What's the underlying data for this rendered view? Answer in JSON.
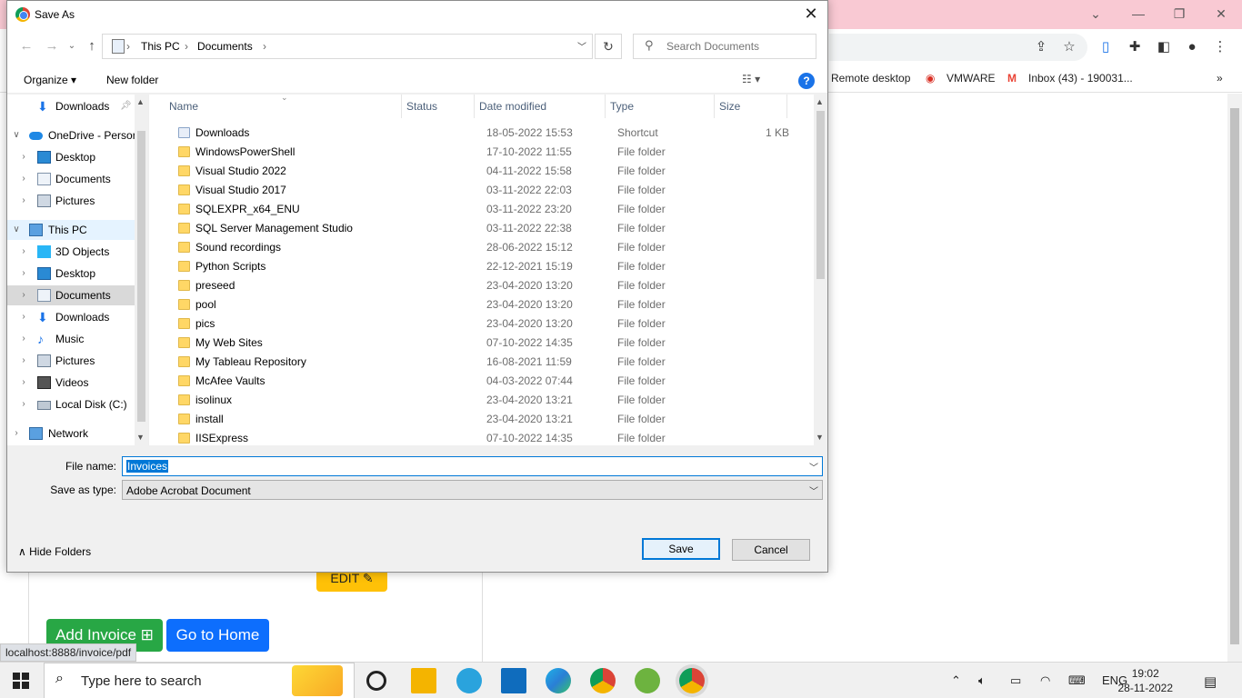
{
  "browser": {
    "bookmarks": [
      "Remote desktop",
      "VMWARE",
      "Inbox (43) - 190031..."
    ],
    "status_url": "localhost:8888/invoice/pdf",
    "page_buttons": {
      "edit": "EDIT",
      "add_invoice": "Add Invoice",
      "go_home": "Go to Home"
    }
  },
  "dialog": {
    "title": "Save As",
    "breadcrumb": [
      "This PC",
      "Documents"
    ],
    "search_placeholder": "Search Documents",
    "organize": "Organize",
    "new_folder": "New folder",
    "nav_items": [
      {
        "label": "Downloads",
        "icon": "downloads-icon",
        "pinned": true
      },
      {
        "label": "OneDrive - Persor",
        "icon": "onedrive-icon"
      },
      {
        "label": "Desktop",
        "icon": "desktop-icon"
      },
      {
        "label": "Documents",
        "icon": "documents-icon"
      },
      {
        "label": "Pictures",
        "icon": "pictures-icon"
      },
      {
        "label": "This PC",
        "icon": "this-pc-icon"
      },
      {
        "label": "3D Objects",
        "icon": "3d-objects-icon"
      },
      {
        "label": "Desktop",
        "icon": "desktop-icon"
      },
      {
        "label": "Documents",
        "icon": "documents-icon"
      },
      {
        "label": "Downloads",
        "icon": "downloads-icon"
      },
      {
        "label": "Music",
        "icon": "music-icon"
      },
      {
        "label": "Pictures",
        "icon": "pictures-icon"
      },
      {
        "label": "Videos",
        "icon": "videos-icon"
      },
      {
        "label": "Local Disk (C:)",
        "icon": "local-disk-icon"
      },
      {
        "label": "Network",
        "icon": "network-icon"
      }
    ],
    "columns": [
      "Name",
      "Status",
      "Date modified",
      "Type",
      "Size"
    ],
    "files": [
      {
        "name": "Downloads",
        "date": "18-05-2022 15:53",
        "type": "Shortcut",
        "size": "1 KB"
      },
      {
        "name": "WindowsPowerShell",
        "date": "17-10-2022 11:55",
        "type": "File folder",
        "size": ""
      },
      {
        "name": "Visual Studio 2022",
        "date": "04-11-2022 15:58",
        "type": "File folder",
        "size": ""
      },
      {
        "name": "Visual Studio 2017",
        "date": "03-11-2022 22:03",
        "type": "File folder",
        "size": ""
      },
      {
        "name": "SQLEXPR_x64_ENU",
        "date": "03-11-2022 23:20",
        "type": "File folder",
        "size": ""
      },
      {
        "name": "SQL Server Management Studio",
        "date": "03-11-2022 22:38",
        "type": "File folder",
        "size": ""
      },
      {
        "name": "Sound recordings",
        "date": "28-06-2022 15:12",
        "type": "File folder",
        "size": ""
      },
      {
        "name": "Python Scripts",
        "date": "22-12-2021 15:19",
        "type": "File folder",
        "size": ""
      },
      {
        "name": "preseed",
        "date": "23-04-2020 13:20",
        "type": "File folder",
        "size": ""
      },
      {
        "name": "pool",
        "date": "23-04-2020 13:20",
        "type": "File folder",
        "size": ""
      },
      {
        "name": "pics",
        "date": "23-04-2020 13:20",
        "type": "File folder",
        "size": ""
      },
      {
        "name": "My Web Sites",
        "date": "07-10-2022 14:35",
        "type": "File folder",
        "size": ""
      },
      {
        "name": "My Tableau Repository",
        "date": "16-08-2021 11:59",
        "type": "File folder",
        "size": ""
      },
      {
        "name": "McAfee Vaults",
        "date": "04-03-2022 07:44",
        "type": "File folder",
        "size": ""
      },
      {
        "name": "isolinux",
        "date": "23-04-2020 13:21",
        "type": "File folder",
        "size": ""
      },
      {
        "name": "install",
        "date": "23-04-2020 13:21",
        "type": "File folder",
        "size": ""
      },
      {
        "name": "IISExpress",
        "date": "07-10-2022 14:35",
        "type": "File folder",
        "size": ""
      }
    ],
    "file_name_label": "File name:",
    "file_name_value": "Invoices",
    "save_type_label": "Save as type:",
    "save_type_value": "Adobe Acrobat Document",
    "hide_folders": "Hide Folders",
    "save": "Save",
    "cancel": "Cancel"
  },
  "taskbar": {
    "search_placeholder": "Type here to search",
    "lang": "ENG",
    "time": "19:02",
    "date": "28-11-2022"
  }
}
